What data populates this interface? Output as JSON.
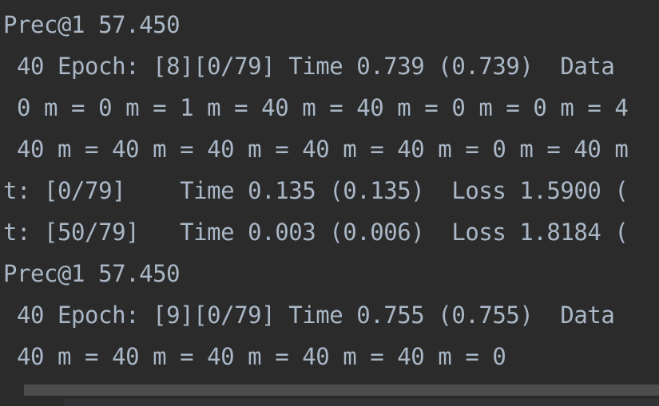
{
  "console": {
    "lines": [
      "Prec@1 57.450",
      " 40 Epoch: [8][0/79] Time 0.739 (0.739)  Data",
      " 0 m = 0 m = 1 m = 40 m = 40 m = 0 m = 0 m = 4",
      " 40 m = 40 m = 40 m = 40 m = 40 m = 0 m = 40 m",
      "t: [0/79]    Time 0.135 (0.135)  Loss 1.5900 (",
      "t: [50/79]   Time 0.003 (0.006)  Loss 1.8184 (",
      "Prec@1 57.450",
      " 40 Epoch: [9][0/79] Time 0.755 (0.755)  Data",
      " 40 m = 40 m = 40 m = 40 m = 40 m = 0"
    ]
  },
  "colors": {
    "background": "#2b2b2b",
    "text": "#a9b7c6",
    "scrollbar_thumb": "#4d4d4d"
  }
}
